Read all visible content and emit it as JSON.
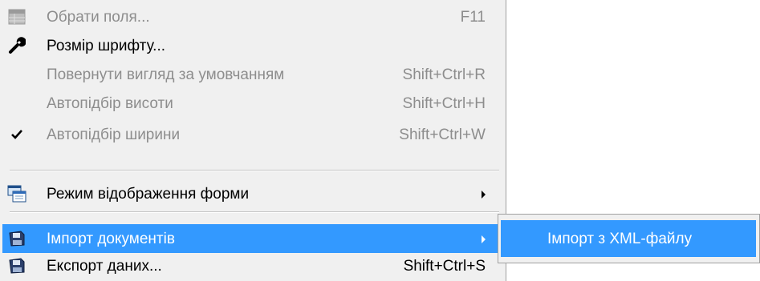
{
  "menu": {
    "items": [
      {
        "label": "Обрати поля...",
        "shortcut": "F11",
        "icon": "table-fields-icon",
        "disabled": true
      },
      {
        "label": "Розмір шрифту...",
        "shortcut": "",
        "icon": "wrench-icon",
        "disabled": false
      },
      {
        "label": "Повернути вигляд за умовчанням",
        "shortcut": "Shift+Ctrl+R",
        "icon": "",
        "disabled": true
      },
      {
        "label": "Автопідбір висоти",
        "shortcut": "Shift+Ctrl+H",
        "icon": "",
        "disabled": true
      },
      {
        "label": "Автопідбір ширини",
        "shortcut": "Shift+Ctrl+W",
        "icon": "checkmark-icon",
        "disabled": true,
        "checked": true
      },
      {
        "label": "Режим відображення форми",
        "shortcut": "",
        "icon": "form-view-icon",
        "disabled": false,
        "submenu": true
      },
      {
        "label": "Імпорт документів",
        "shortcut": "",
        "icon": "floppy-disk-icon",
        "disabled": false,
        "submenu": true,
        "highlighted": true
      },
      {
        "label": "Експорт даних...",
        "shortcut": "Shift+Ctrl+S",
        "icon": "floppy-disk-icon",
        "disabled": false
      }
    ]
  },
  "submenu": {
    "items": [
      {
        "label": "Імпорт з XML-файлу",
        "highlighted": true
      }
    ]
  },
  "colors": {
    "menu_bg": "#f0f0f0",
    "highlight": "#3399ff",
    "disabled_text": "#8d8d8d"
  }
}
